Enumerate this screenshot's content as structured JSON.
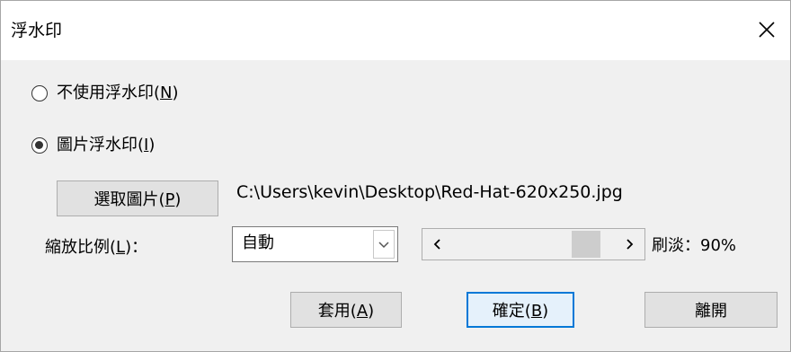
{
  "window": {
    "title": "浮水印",
    "close_glyph": "✕"
  },
  "options": {
    "no_watermark_label": "不使用浮水印(N)",
    "no_watermark_checked": false,
    "picture_watermark_label": "圖片浮水印(I)",
    "picture_watermark_checked": true
  },
  "picture": {
    "select_button_label": "選取圖片(P)",
    "file_path": "C:\\Users\\kevin\\Desktop\\Red-Hat-620x250.jpg"
  },
  "scale": {
    "label": "縮放比例(L)：",
    "selected": "自動"
  },
  "washout": {
    "label": "刷淡：90%",
    "value_percent": 90
  },
  "buttons": {
    "apply_label": "套用(A)",
    "ok_label": "確定(B)",
    "close_label": "離開"
  }
}
